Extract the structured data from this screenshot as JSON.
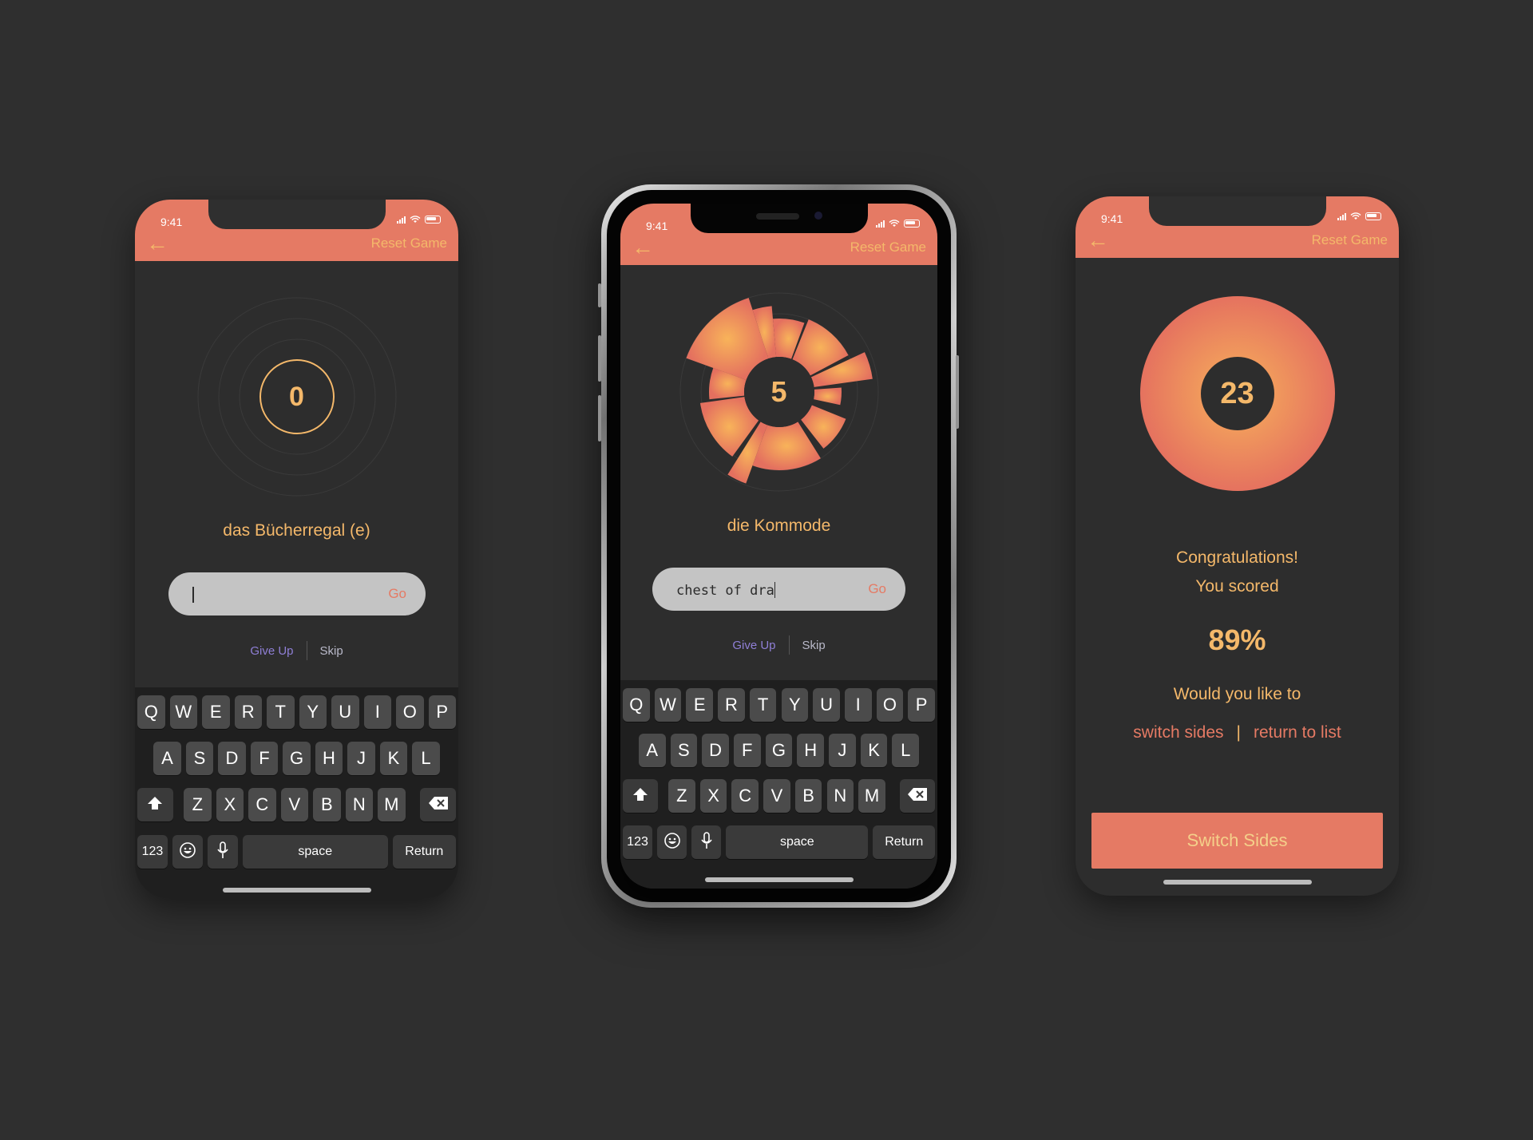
{
  "status_time": "9:41",
  "nav": {
    "back_icon": "arrow-left-icon",
    "reset_label": "Reset Game"
  },
  "colors": {
    "accent": "#e57a64",
    "gold": "#f4b86a",
    "background": "#2f2f2f",
    "purple": "#8f7fd6"
  },
  "screen1": {
    "score": "0",
    "word": "das Bücherregal (e)",
    "input_value": "",
    "go_label": "Go",
    "give_up": "Give Up",
    "skip": "Skip"
  },
  "screen2": {
    "score": "5",
    "word": "die Kommode",
    "input_value": "chest of dra",
    "go_label": "Go",
    "give_up": "Give Up",
    "skip": "Skip"
  },
  "screen3": {
    "score": "23",
    "congrats_line1": "Congratulations!",
    "congrats_line2": "You scored",
    "percent": "89%",
    "question": "Would you like to",
    "option1": "switch sides",
    "separator": "|",
    "option2": "return to list",
    "button": "Switch Sides"
  },
  "keyboard": {
    "row1": [
      "Q",
      "W",
      "E",
      "R",
      "T",
      "Y",
      "U",
      "I",
      "O",
      "P"
    ],
    "row2": [
      "A",
      "S",
      "D",
      "F",
      "G",
      "H",
      "J",
      "K",
      "L"
    ],
    "row3": [
      "Z",
      "X",
      "C",
      "V",
      "B",
      "N",
      "M"
    ],
    "numbers": "123",
    "space": "space",
    "return": "Return",
    "shift_icon": "shift-arrow-icon",
    "delete_icon": "backspace-icon",
    "emoji_icon": "emoji-icon",
    "mic_icon": "microphone-icon"
  }
}
